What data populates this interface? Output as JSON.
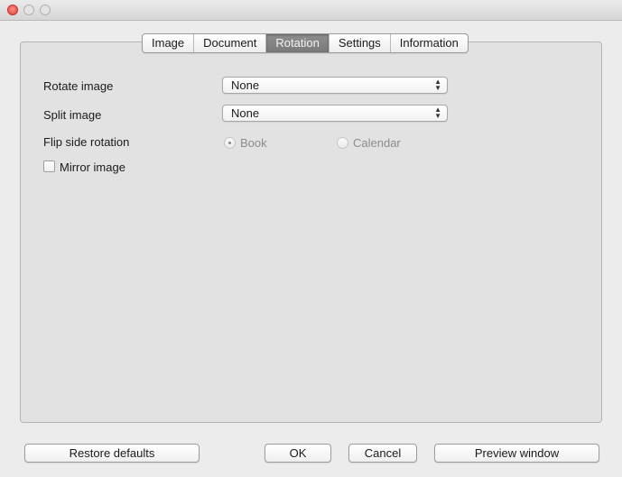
{
  "window": {
    "controls": {
      "close_icon": "close-icon",
      "minimize_icon": "minimize-icon",
      "zoom_icon": "zoom-icon"
    }
  },
  "tabs": {
    "items": [
      "Image",
      "Document",
      "Rotation",
      "Settings",
      "Information"
    ],
    "active": "Rotation"
  },
  "rotation": {
    "rotate_image_label": "Rotate image",
    "rotate_image_value": "None",
    "split_image_label": "Split image",
    "split_image_value": "None",
    "flip_side_label": "Flip side rotation",
    "flip_option_book": "Book",
    "flip_option_calendar": "Calendar",
    "flip_selected": "Book",
    "mirror_label": "Mirror image",
    "mirror_checked": false
  },
  "buttons": {
    "restore": "Restore defaults",
    "ok": "OK",
    "cancel": "Cancel",
    "preview": "Preview window"
  },
  "colors": {
    "close_red": "#e0443a",
    "active_tab": "#8a8a8a",
    "disabled_text": "#8c8c8c"
  }
}
